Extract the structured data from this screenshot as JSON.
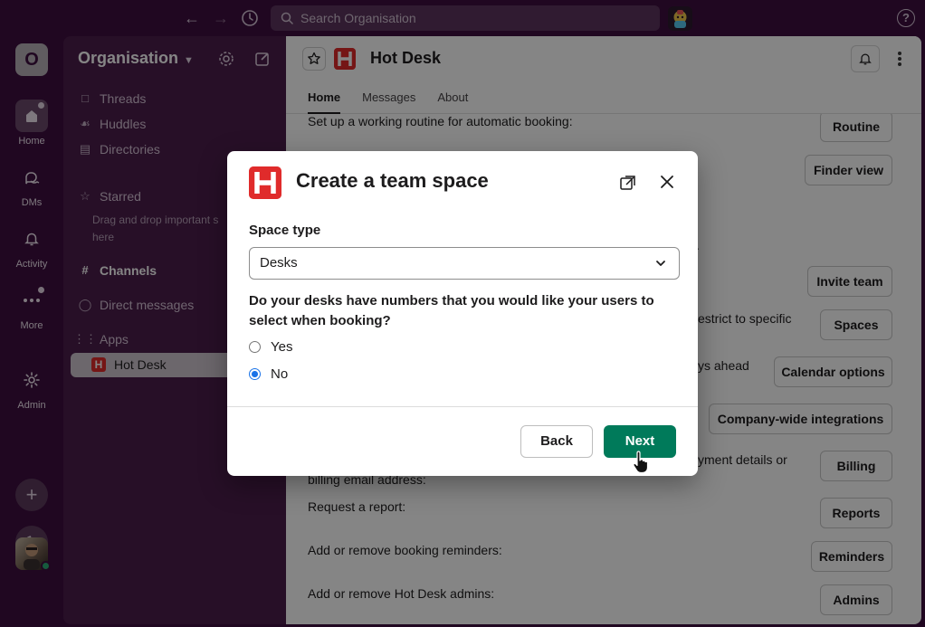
{
  "topbar": {
    "back_icon": "arrow-left-icon",
    "forward_icon": "arrow-right-icon",
    "history_icon": "clock-icon",
    "search_placeholder": "Search Organisation",
    "help_icon": "question-circle-icon"
  },
  "rail": {
    "workspace_initial": "O",
    "items": [
      {
        "label": "Home",
        "icon": "home-icon"
      },
      {
        "label": "DMs",
        "icon": "dms-icon"
      },
      {
        "label": "Activity",
        "icon": "bell-icon"
      },
      {
        "label": "More",
        "icon": "more-dots-icon"
      },
      {
        "label": "Admin",
        "icon": "gear-icon"
      }
    ]
  },
  "sidebar": {
    "org_name": "Organisation",
    "threads": "Threads",
    "huddles": "Huddles",
    "directories": "Directories",
    "starred": "Starred",
    "starred_hint_line1": "Drag and drop important s",
    "starred_hint_line2": "here",
    "channels": "Channels",
    "direct_messages": "Direct messages",
    "apps": "Apps",
    "selected_app": "Hot Desk"
  },
  "main": {
    "app_name": "Hot Desk",
    "tabs": [
      {
        "label": "Home",
        "active": true
      },
      {
        "label": "Messages",
        "active": false
      },
      {
        "label": "About",
        "active": false
      }
    ],
    "rows": {
      "routine_text": "Set up a working routine for automatic booking:",
      "routine_btn": "Routine",
      "finder_btn": "Finder view",
      "invite_text_tail": ".",
      "invite_btn": "Invite team",
      "spaces_text_tail": "estrict to specific",
      "spaces_btn": "Spaces",
      "calendar_text_tail": "ys ahead",
      "calendar_btn": "Calendar options",
      "integrations_btn": "Company-wide integrations",
      "billing_text_tail": "yment details or",
      "billing_text_line2": "billing email address:",
      "billing_btn": "Billing",
      "reports_text": "Request a report:",
      "reports_btn": "Reports",
      "reminders_text": "Add or remove booking reminders:",
      "reminders_btn": "Reminders",
      "admins_text": "Add or remove Hot Desk admins:",
      "admins_btn": "Admins"
    }
  },
  "modal": {
    "title": "Create a team space",
    "space_type_label": "Space type",
    "space_type_value": "Desks",
    "question": "Do your desks have numbers that you would like your users to select when booking?",
    "options": [
      {
        "label": "Yes",
        "checked": false
      },
      {
        "label": "No",
        "checked": true
      }
    ],
    "back_label": "Back",
    "next_label": "Next"
  },
  "colors": {
    "aubergine": "#3f0e40",
    "sidebar": "#4b1d4c",
    "brand_red": "#e02b2b",
    "primary_green": "#007a5a",
    "radio_blue": "#1a73e8"
  }
}
